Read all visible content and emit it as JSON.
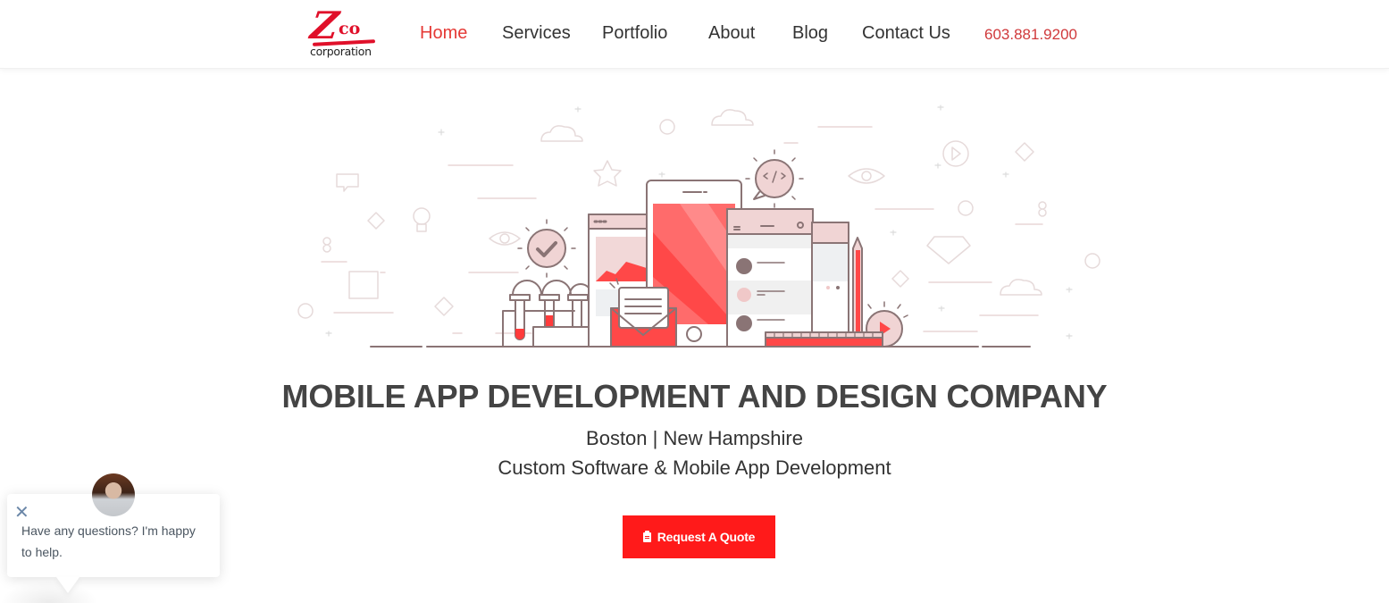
{
  "header": {
    "logo": {
      "mark": "Z",
      "mark_suffix": "co",
      "subtitle": "corporation"
    },
    "nav": [
      {
        "label": "Home",
        "active": true
      },
      {
        "label": "Services",
        "active": false
      },
      {
        "label": "Portfolio",
        "active": false
      },
      {
        "label": "About",
        "active": false
      },
      {
        "label": "Blog",
        "active": false
      },
      {
        "label": "Contact Us",
        "active": false
      }
    ],
    "phone": "603.881.9200"
  },
  "hero": {
    "illustration": "mobile-app-development-illustration",
    "headline": "MOBILE APP DEVELOPMENT AND DESIGN COMPANY",
    "locations": "Boston | New Hampshire",
    "tagline": "Custom Software & Mobile App Development",
    "cta": {
      "label": "Request A Quote",
      "icon": "clipboard-icon"
    }
  },
  "chat_widget": {
    "message": "Have any questions? I'm happy to help.",
    "close_icon": "close-icon",
    "avatar": "agent-avatar"
  },
  "colors": {
    "brand_red": "#e0102a",
    "nav_active": "#e53935",
    "phone": "#d0393b",
    "cta_bg": "#ff1a1a",
    "text_dark": "#444444",
    "illustration_outline": "#8a7475",
    "illustration_pink": "#f0d4d4",
    "illustration_red": "#ff4848"
  }
}
